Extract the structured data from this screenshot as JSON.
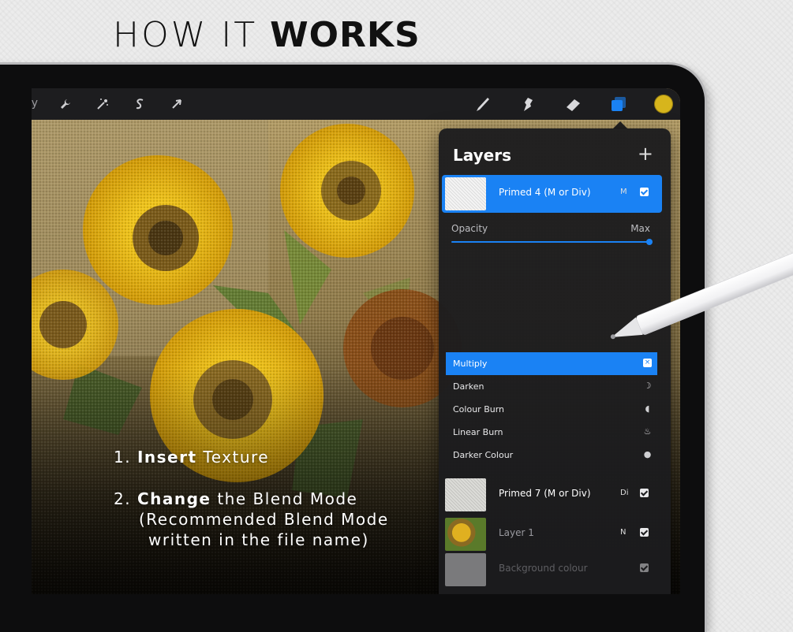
{
  "page": {
    "title_light": "HOW IT",
    "title_bold": "WORKS"
  },
  "toolbar": {
    "gallery_label_fragment": "ry",
    "left_icons": [
      "wrench-icon",
      "magic-wand-icon",
      "selection-s-icon",
      "arrow-transform-icon"
    ],
    "right_icons": [
      "brush-icon",
      "smudge-icon",
      "eraser-icon",
      "layers-icon"
    ],
    "color_swatch": "#d7b51c"
  },
  "layers_panel": {
    "title": "Layers",
    "add_symbol": "+",
    "active_layer": {
      "name": "Primed 4 (M or Div)",
      "mode": "M",
      "visible": true
    },
    "opacity": {
      "label": "Opacity",
      "value_label": "Max",
      "value": 1.0
    },
    "blend_modes": [
      {
        "label": "Multiply",
        "icon": "×",
        "selected": true
      },
      {
        "label": "Darken",
        "icon": "☽",
        "selected": false
      },
      {
        "label": "Colour Burn",
        "icon": "◖",
        "selected": false
      },
      {
        "label": "Linear Burn",
        "icon": "♨",
        "selected": false
      },
      {
        "label": "Darker Colour",
        "icon": "●",
        "selected": false
      }
    ],
    "layers": [
      {
        "name": "Primed 7 (M or Div)",
        "mode": "Di",
        "visible": true
      },
      {
        "name": "Layer 1",
        "mode": "N",
        "visible": true
      },
      {
        "name": "Background colour",
        "mode": "",
        "visible": true
      }
    ]
  },
  "instructions": {
    "step1_num": "1.",
    "step1_bold": "Insert",
    "step1_rest": "Texture",
    "step2_num": "2.",
    "step2_bold": "Change",
    "step2_rest": "the Blend Mode",
    "step2_line2": "(Recommended Blend Mode",
    "step2_line3": "written in the file name)"
  },
  "colors": {
    "accent_blue": "#1a82f4",
    "panel_bg": "#1c1c1e",
    "sunflower_yellow": "#e9be1a"
  }
}
